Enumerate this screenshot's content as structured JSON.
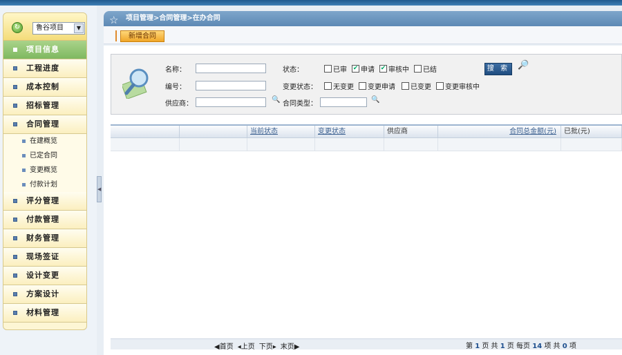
{
  "project_select": {
    "value": "鲁谷项目"
  },
  "breadcrumb": "项目管理>合同管理>在办合同",
  "toolbar": {
    "new_contract": "新增合同"
  },
  "sidebar": {
    "items": [
      {
        "label": "项目信息",
        "active": true
      },
      {
        "label": "工程进度"
      },
      {
        "label": "成本控制"
      },
      {
        "label": "招标管理"
      },
      {
        "label": "合同管理"
      },
      {
        "label": "评分管理"
      },
      {
        "label": "付款管理"
      },
      {
        "label": "财务管理"
      },
      {
        "label": "现场签证"
      },
      {
        "label": "设计变更"
      },
      {
        "label": "方案设计"
      },
      {
        "label": "材料管理"
      }
    ],
    "contract_sub": [
      "在建概览",
      "已定合同",
      "变更概览",
      "付款计划"
    ]
  },
  "search": {
    "name_label": "名称：",
    "code_label": "编号：",
    "supplier_label": "供应商：",
    "status_label": "状态：",
    "change_status_label": "变更状态：",
    "contract_type_label": "合同类型：",
    "status_options": [
      {
        "label": "已审",
        "checked": false
      },
      {
        "label": "申请",
        "checked": true
      },
      {
        "label": "审核中",
        "checked": true
      },
      {
        "label": "已结",
        "checked": false
      }
    ],
    "change_options": [
      {
        "label": "无变更",
        "checked": false
      },
      {
        "label": "变更申请",
        "checked": false
      },
      {
        "label": "已变更",
        "checked": false
      },
      {
        "label": "变更审核中",
        "checked": false
      }
    ],
    "button": "搜 索"
  },
  "table": {
    "columns": [
      "",
      "",
      "当前状态",
      "变更状态",
      "供应商",
      "合同总金额(元)",
      "已批(元)"
    ]
  },
  "pager": {
    "first": "首页",
    "prev": "上页",
    "next": "下页",
    "last": "末页",
    "info_prefix": "第",
    "page": "1",
    "info_mid1": "页 共",
    "total_pages": "1",
    "info_mid2": "页 每页",
    "per_page": "14",
    "info_mid3": "项 共",
    "total_items": "0",
    "info_suffix": "项"
  },
  "colors": {
    "accent": "#5d89b5",
    "active_menu": "#7fb860",
    "new_button": "#f0a628"
  }
}
